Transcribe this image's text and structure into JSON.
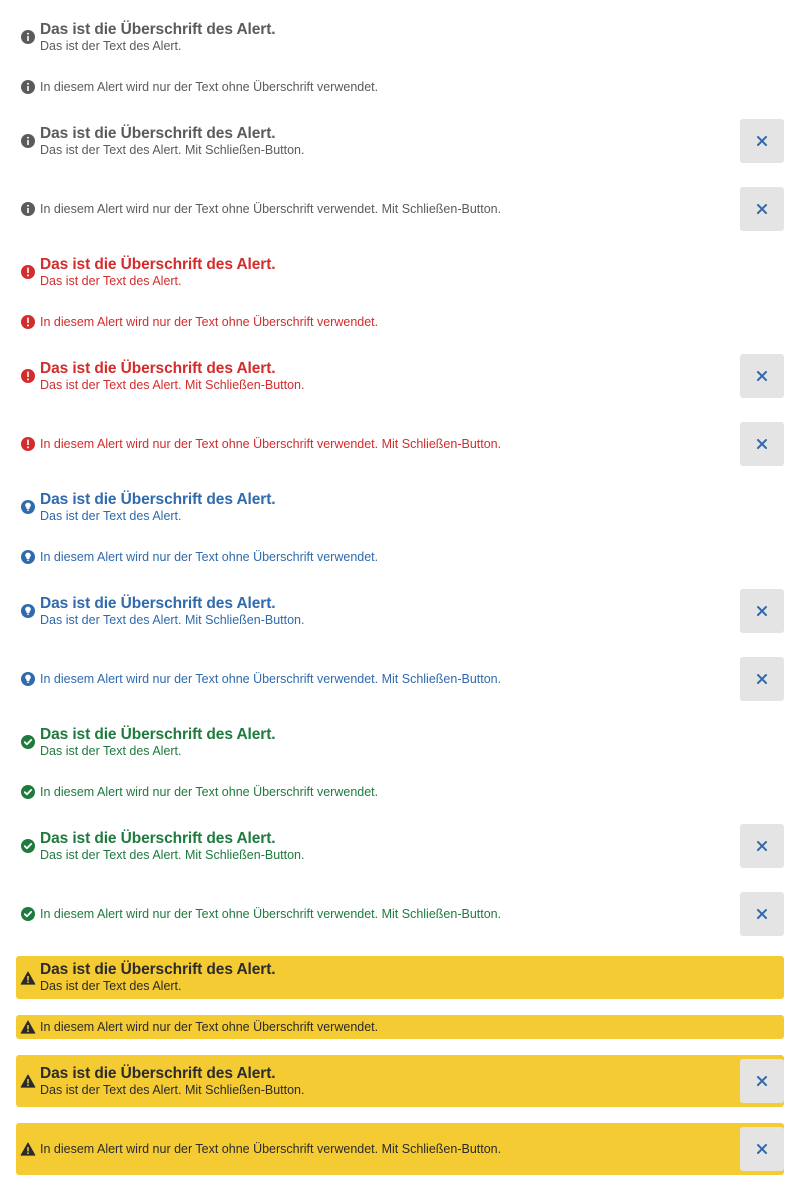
{
  "colors": {
    "neutral": "#5b5b5b",
    "error": "#d22c2c",
    "info": "#2f6aad",
    "success": "#1f7a3e",
    "warning_text": "#2b2b2b",
    "warning_background": "#f5cb33",
    "close_button_background": "#e4e4e4",
    "close_icon": "#2f6aad"
  },
  "icons": {
    "neutral": "info-circle-icon",
    "error": "exclamation-circle-icon",
    "info": "lightbulb-circle-icon",
    "success": "check-circle-icon",
    "warning": "warning-triangle-icon",
    "close": "close-icon"
  },
  "alerts": [
    {
      "heading": "Das ist die Überschrift des Alert.",
      "text": "Das ist der Text des Alert."
    },
    {
      "text": "In diesem Alert wird nur der Text ohne Überschrift verwendet."
    },
    {
      "heading": "Das ist die Überschrift des Alert.",
      "text": "Das ist der Text des Alert. Mit Schließen-Button."
    },
    {
      "text": "In diesem Alert wird nur der Text ohne Überschrift verwendet. Mit Schließen-Button."
    },
    {
      "heading": "Das ist die Überschrift des Alert.",
      "text": "Das ist der Text des Alert."
    },
    {
      "text": "In diesem Alert wird nur der Text ohne Überschrift verwendet."
    },
    {
      "heading": "Das ist die Überschrift des Alert.",
      "text": "Das ist der Text des Alert. Mit Schließen-Button."
    },
    {
      "text": "In diesem Alert wird nur der Text ohne Überschrift verwendet. Mit Schließen-Button."
    },
    {
      "heading": "Das ist die Überschrift des Alert.",
      "text": "Das ist der Text des Alert."
    },
    {
      "text": "In diesem Alert wird nur der Text ohne Überschrift verwendet."
    },
    {
      "heading": "Das ist die Überschrift des Alert.",
      "text": "Das ist der Text des Alert. Mit Schließen-Button."
    },
    {
      "text": "In diesem Alert wird nur der Text ohne Überschrift verwendet. Mit Schließen-Button."
    },
    {
      "heading": "Das ist die Überschrift des Alert.",
      "text": "Das ist der Text des Alert."
    },
    {
      "text": "In diesem Alert wird nur der Text ohne Überschrift verwendet."
    },
    {
      "heading": "Das ist die Überschrift des Alert.",
      "text": "Das ist der Text des Alert. Mit Schließen-Button."
    },
    {
      "text": "In diesem Alert wird nur der Text ohne Überschrift verwendet. Mit Schließen-Button."
    },
    {
      "heading": "Das ist die Überschrift des Alert.",
      "text": "Das ist der Text des Alert."
    },
    {
      "text": "In diesem Alert wird nur der Text ohne Überschrift verwendet."
    },
    {
      "heading": "Das ist die Überschrift des Alert.",
      "text": "Das ist der Text des Alert. Mit Schließen-Button."
    },
    {
      "text": "In diesem Alert wird nur der Text ohne Überschrift verwendet. Mit Schließen-Button."
    }
  ]
}
